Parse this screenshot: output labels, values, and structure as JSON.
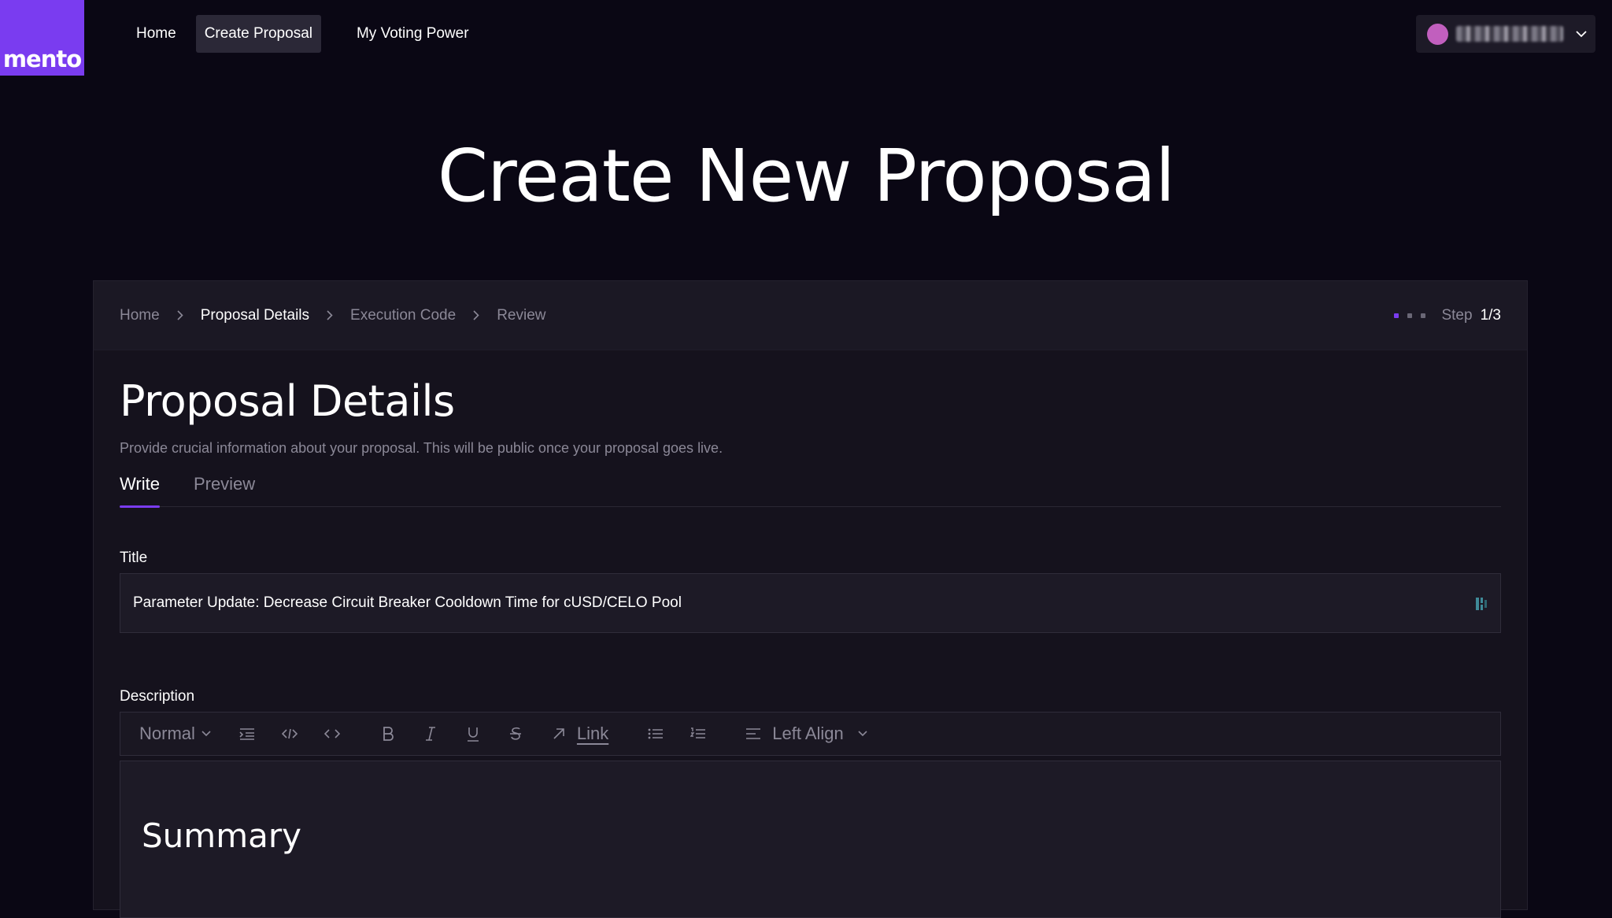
{
  "brand": {
    "logo_text": "mento",
    "color": "#7a3cf0"
  },
  "nav": {
    "items": [
      {
        "label": "Home",
        "active": false
      },
      {
        "label": "Create Proposal",
        "active": true
      },
      {
        "label": "My Voting Power",
        "active": false
      }
    ]
  },
  "wallet": {
    "avatar_color": "#c15fbe"
  },
  "hero": {
    "title": "Create New Proposal"
  },
  "breadcrumb": {
    "items": [
      "Home",
      "Proposal Details",
      "Execution Code",
      "Review"
    ],
    "current_index": 1
  },
  "stepper": {
    "label": "Step",
    "value": "1/3"
  },
  "section": {
    "title": "Proposal Details",
    "subtitle": "Provide crucial information about your proposal. This will be public once your proposal goes live."
  },
  "tabs": [
    {
      "label": "Write",
      "active": true
    },
    {
      "label": "Preview",
      "active": false
    }
  ],
  "form": {
    "title_label": "Title",
    "title_value": "Parameter Update: Decrease Circuit Breaker Cooldown Time for cUSD/CELO Pool",
    "description_label": "Description"
  },
  "toolbar": {
    "format_select": "Normal",
    "link_label": "Link",
    "align_select": "Left Align",
    "icons": [
      "indent-icon",
      "code-icon",
      "code-block-icon",
      "bold-icon",
      "italic-icon",
      "underline-icon",
      "strikethrough-icon",
      "link-arrow-icon",
      "bullet-list-icon",
      "numbered-list-icon",
      "align-left-icon"
    ]
  },
  "editor": {
    "heading": "Summary"
  }
}
